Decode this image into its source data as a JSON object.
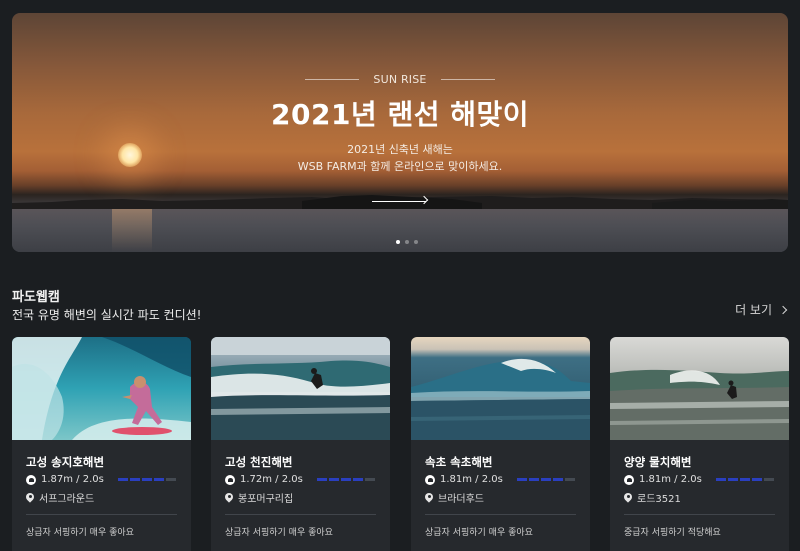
{
  "hero": {
    "eyebrow": "SUN RISE",
    "title": "2021년 랜선 해맞이",
    "subtitle_line1": "2021년 신축년 새해는",
    "subtitle_line2": "WSB FARM과 함께 온라인으로 맞이하세요.",
    "slide_count": 3,
    "active_slide": 1
  },
  "section": {
    "title": "파도웹캠",
    "subtitle": "전국 유명 해변의 실시간 파도 컨디션!",
    "more_label": "더 보기"
  },
  "colors": {
    "background": "#1b1e21",
    "card": "#26292d",
    "bar_active": "#2a3fbf",
    "bar_inactive": "#444a52"
  },
  "cards": [
    {
      "name": "고성 송지호해변",
      "wave": "1.87m / 2.0s",
      "level": 4,
      "level_max": 5,
      "shop": "서프그라운드",
      "description": "상급자 서핑하기 매우 좋아요"
    },
    {
      "name": "고성 천진해변",
      "wave": "1.72m / 2.0s",
      "level": 4,
      "level_max": 5,
      "shop": "봉포머구리집",
      "description": "상급자 서핑하기 매우 좋아요"
    },
    {
      "name": "속초 속초해변",
      "wave": "1.81m / 2.0s",
      "level": 4,
      "level_max": 5,
      "shop": "브라더후드",
      "description": "상급자 서핑하기 매우 좋아요"
    },
    {
      "name": "양양 물치해변",
      "wave": "1.81m / 2.0s",
      "level": 4,
      "level_max": 5,
      "shop": "로드3521",
      "description": "중급자 서핑하기 적당해요"
    }
  ]
}
